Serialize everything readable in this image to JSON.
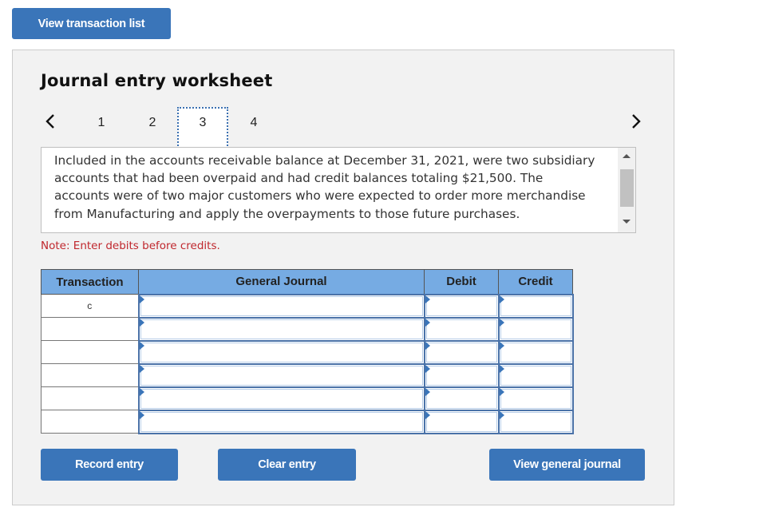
{
  "top_button": {
    "label": "View transaction list"
  },
  "worksheet": {
    "title": "Journal entry worksheet",
    "nav": {
      "prev_icon": "chevron-left-icon",
      "next_icon": "chevron-right-icon",
      "tabs": [
        {
          "label": "1",
          "selected": false
        },
        {
          "label": "2",
          "selected": false
        },
        {
          "label": "3",
          "selected": true
        },
        {
          "label": "4",
          "selected": false
        }
      ]
    },
    "description": "Included in the accounts receivable balance at December 31, 2021, were two subsidiary accounts that had been overpaid and had credit balances totaling $21,500. The accounts were of two major customers who were expected to order more merchandise from Manufacturing and apply the overpayments to those future purchases.",
    "note": "Note: Enter debits before credits.",
    "table": {
      "headers": [
        "Transaction",
        "General Journal",
        "Debit",
        "Credit"
      ],
      "rows": [
        {
          "transaction": "c",
          "account": "",
          "debit": "",
          "credit": ""
        },
        {
          "transaction": "",
          "account": "",
          "debit": "",
          "credit": ""
        },
        {
          "transaction": "",
          "account": "",
          "debit": "",
          "credit": ""
        },
        {
          "transaction": "",
          "account": "",
          "debit": "",
          "credit": ""
        },
        {
          "transaction": "",
          "account": "",
          "debit": "",
          "credit": ""
        },
        {
          "transaction": "",
          "account": "",
          "debit": "",
          "credit": ""
        }
      ]
    },
    "buttons": {
      "record": "Record entry",
      "clear": "Clear entry",
      "view_general_journal": "View general journal"
    }
  },
  "colors": {
    "button_blue": "#3a75b9",
    "header_blue": "#76abe3",
    "note_red": "#c0272d",
    "panel_bg": "#f2f2f2"
  }
}
